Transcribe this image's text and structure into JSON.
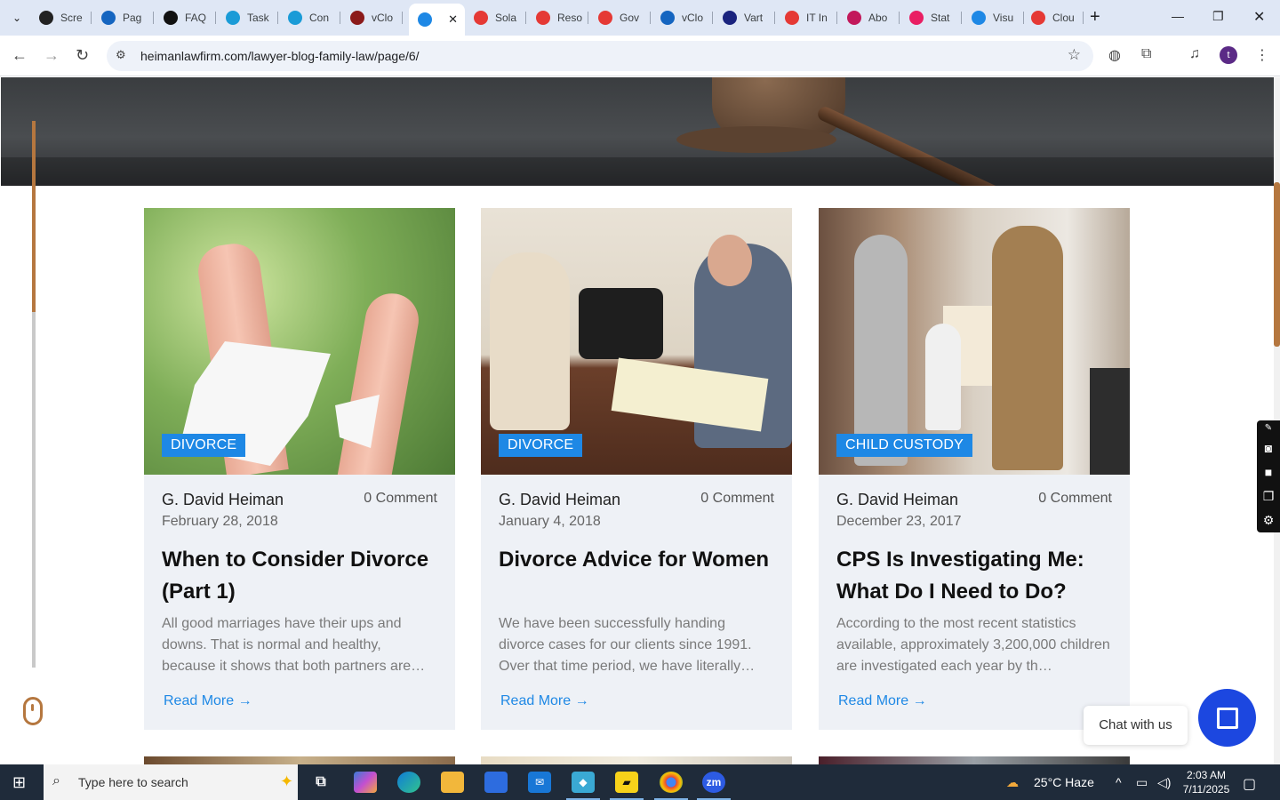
{
  "tabs": [
    {
      "label": "Scre",
      "color": "#222"
    },
    {
      "label": "Pag",
      "color": "#1565c0"
    },
    {
      "label": "FAQ",
      "color": "#111"
    },
    {
      "label": "Task",
      "color": "#1a9bd7"
    },
    {
      "label": "Con",
      "color": "#1a9bd7"
    },
    {
      "label": "vClo",
      "color": "#8b1a1a"
    },
    {
      "label": "",
      "color": "#1e88e5",
      "active": true
    },
    {
      "label": "Sola",
      "color": "#e53935"
    },
    {
      "label": "Reso",
      "color": "#e53935"
    },
    {
      "label": "Gov",
      "color": "#e53935"
    },
    {
      "label": "vClo",
      "color": "#1565c0"
    },
    {
      "label": "Vart",
      "color": "#1a237e"
    },
    {
      "label": "IT In",
      "color": "#e53935"
    },
    {
      "label": "Abo",
      "color": "#c2185b"
    },
    {
      "label": "Stat",
      "color": "#e91e63"
    },
    {
      "label": "Visu",
      "color": "#1e88e5"
    },
    {
      "label": "Clou",
      "color": "#e53935"
    }
  ],
  "url": "heimanlawfirm.com/lawyer-blog-family-law/page/6/",
  "profile_initial": "t",
  "posts": [
    {
      "category": "DIVORCE",
      "author": "G. David Heiman",
      "comments": "0 Comment",
      "date": "February 28, 2018",
      "title": "When to Consider Divorce (Part 1)",
      "excerpt": "All good marriages have their ups and downs. That is normal and healthy, because it shows that both partners are…",
      "read_more": "Read More →"
    },
    {
      "category": "DIVORCE",
      "author": "G. David Heiman",
      "comments": "0 Comment",
      "date": "January 4, 2018",
      "title": "Divorce Advice for Women",
      "excerpt": "We have been successfully handing divorce cases for our clients since 1991. Over that time period, we have literally…",
      "read_more": "Read More →"
    },
    {
      "category": "CHILD CUSTODY",
      "author": "G. David Heiman",
      "comments": "0 Comment",
      "date": "December 23, 2017",
      "title": "CPS Is Investigating Me: What Do I Need to Do?",
      "excerpt": "According to the most recent statistics available, approximately 3,200,000 children are investigated each year by th…",
      "read_more": "Read More →"
    }
  ],
  "chat": {
    "label": "Chat with us"
  },
  "taskbar": {
    "search_placeholder": "Type here to search",
    "weather": "25°C  Haze",
    "time": "2:03 AM",
    "date": "7/11/2025"
  },
  "icons": {
    "tab_search": "chevron-down-icon",
    "back": "back-arrow-icon",
    "forward": "forward-arrow-icon",
    "reload": "reload-icon",
    "bookmark": "star-icon",
    "extensions": "puzzle-icon",
    "menu": "kebab-menu-icon"
  }
}
